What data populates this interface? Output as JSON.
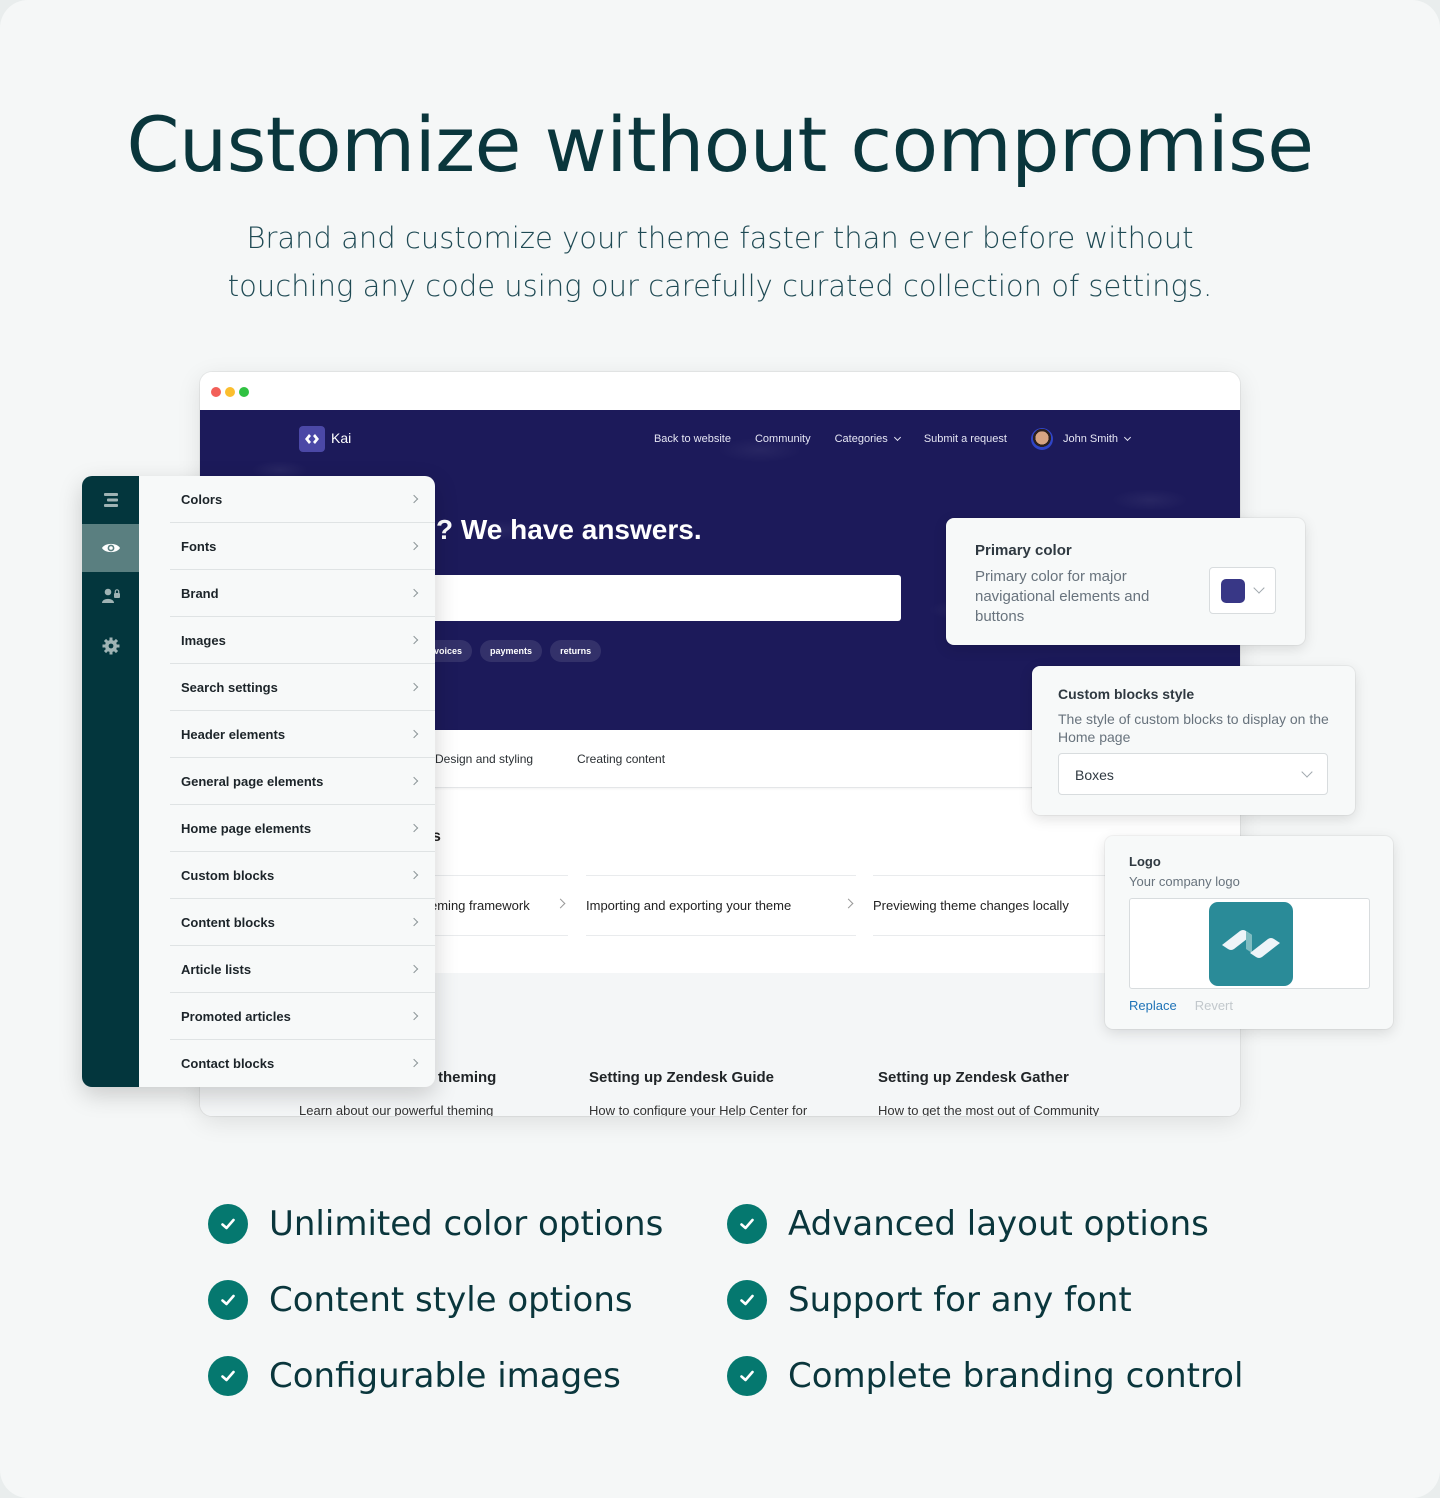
{
  "hero": {
    "title": "Customize without compromise",
    "subtitle": "Brand and customize your theme faster than ever before without touching any code using our carefully curated collection of settings."
  },
  "preview_site": {
    "brand_name": "Kai",
    "nav": [
      "Back to website",
      "Community",
      "Categories",
      "Submit a request"
    ],
    "user_name": "John Smith",
    "headline_partial": "? We have answers.",
    "tags": [
      "voices",
      "payments",
      "returns"
    ],
    "tabs": [
      "Design and styling",
      "Creating content"
    ],
    "section_heading_partial": "s",
    "articles": [
      "eming framework",
      "Importing and exporting your theme",
      "Previewing theme changes locally"
    ],
    "blocks": [
      {
        "title": "theming",
        "desc": "Learn about our powerful theming"
      },
      {
        "title": "Setting up Zendesk Guide",
        "desc": "How to configure your Help Center for"
      },
      {
        "title": "Setting up Zendesk Gather",
        "desc": "How to get the most out of Community"
      }
    ]
  },
  "settings_panel": {
    "rail_icons": [
      "menu-icon",
      "eye-icon",
      "user-lock-icon",
      "gear-icon"
    ],
    "active_rail_index": 1,
    "items": [
      "Colors",
      "Fonts",
      "Brand",
      "Images",
      "Search settings",
      "Header elements",
      "General page elements",
      "Home page elements",
      "Custom blocks",
      "Content blocks",
      "Article lists",
      "Promoted articles",
      "Contact blocks"
    ]
  },
  "primary_color_card": {
    "title": "Primary color",
    "description": "Primary color for major navigational elements and buttons",
    "value": "#383786"
  },
  "custom_blocks_card": {
    "title": "Custom blocks style",
    "description": "The style of custom blocks to display on the Home page",
    "selected": "Boxes"
  },
  "logo_card": {
    "title": "Logo",
    "description": "Your company logo",
    "replace_label": "Replace",
    "revert_label": "Revert"
  },
  "features": [
    "Unlimited color options",
    "Advanced layout options",
    "Content style options",
    "Support for any font",
    "Configurable images",
    "Complete branding control"
  ],
  "colors": {
    "brand_dark": "#03363d",
    "check_green": "#05786f",
    "site_hero": "#1c1a5a",
    "link_blue": "#1f73b7"
  }
}
